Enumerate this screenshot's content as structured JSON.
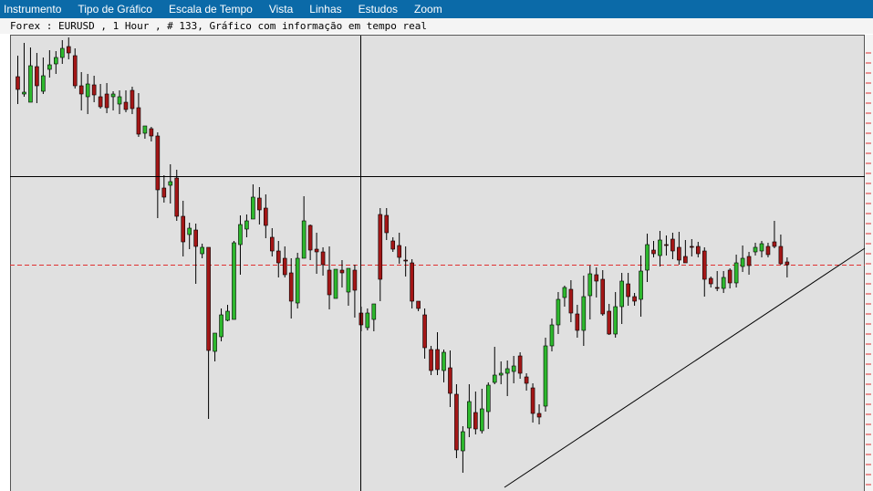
{
  "menu": [
    "Instrumento",
    "Tipo de Gráfico",
    "Escala de Tempo",
    "Vista",
    "Linhas",
    "Estudos",
    "Zoom"
  ],
  "chart_title": "Forex : EURUSD , 1 Hour , # 133, Gráfico com informação em tempo real",
  "colors": {
    "menu_bg": "#0b6aa8",
    "plot_bg": "#e0e0e0",
    "up": "#2db82d",
    "down": "#a31616",
    "ref_line": "#e03030"
  },
  "chart_data": {
    "type": "candlestick",
    "symbol": "EURUSD",
    "timeframe": "1 Hour",
    "candles": [
      [
        84,
        98,
        61,
        114
      ],
      [
        103,
        101,
        47,
        106
      ],
      [
        112,
        72,
        52,
        112
      ],
      [
        73,
        94,
        58,
        113
      ],
      [
        100,
        83,
        63,
        103
      ],
      [
        76,
        71,
        55,
        85
      ],
      [
        70,
        63,
        56,
        81
      ],
      [
        63,
        53,
        44,
        70
      ],
      [
        51,
        58,
        41,
        65
      ],
      [
        61,
        94,
        53,
        97
      ],
      [
        94,
        103,
        79,
        121
      ],
      [
        106,
        92,
        81,
        125
      ],
      [
        93,
        104,
        83,
        112
      ],
      [
        106,
        117,
        92,
        119
      ],
      [
        103,
        118,
        91,
        124
      ],
      [
        106,
        103,
        100,
        121
      ],
      [
        114,
        106,
        99,
        125
      ],
      [
        112,
        120,
        99,
        123
      ],
      [
        99,
        119,
        95,
        125
      ],
      [
        118,
        147,
        102,
        150
      ],
      [
        146,
        138,
        138,
        152
      ],
      [
        141,
        149,
        139,
        155
      ],
      [
        149,
        208,
        145,
        239
      ],
      [
        206,
        216,
        192,
        222
      ],
      [
        203,
        199,
        180,
        223
      ],
      [
        195,
        237,
        186,
        242
      ],
      [
        237,
        265,
        220,
        281
      ],
      [
        257,
        250,
        244,
        273
      ],
      [
        252,
        270,
        245,
        311
      ],
      [
        278,
        271,
        267,
        283
      ],
      [
        271,
        384,
        271,
        459
      ],
      [
        385,
        365,
        365,
        396
      ],
      [
        369,
        345,
        338,
        374
      ],
      [
        351,
        341,
        334,
        352
      ],
      [
        350,
        266,
        264,
        293
      ],
      [
        268,
        246,
        236,
        301
      ],
      [
        251,
        242,
        235,
        260
      ],
      [
        240,
        216,
        202,
        226
      ],
      [
        217,
        230,
        205,
        246
      ],
      [
        228,
        247,
        213,
        261
      ],
      [
        260,
        275,
        250,
        281
      ],
      [
        275,
        288,
        264,
        304
      ],
      [
        283,
        301,
        270,
        304
      ],
      [
        299,
        330,
        283,
        349
      ],
      [
        332,
        283,
        277,
        338
      ],
      [
        283,
        242,
        215,
        272
      ],
      [
        247,
        274,
        246,
        285
      ],
      [
        273,
        276,
        255,
        300
      ],
      [
        276,
        290,
        271,
        302
      ],
      [
        296,
        323,
        270,
        339
      ],
      [
        327,
        295,
        296,
        325
      ],
      [
        296,
        299,
        285,
        315
      ],
      [
        320,
        294,
        294,
        335
      ],
      [
        296,
        318,
        290,
        348
      ],
      [
        343,
        356,
        336,
        363
      ],
      [
        359,
        343,
        338,
        362
      ],
      [
        350,
        333,
        334,
        363
      ],
      [
        235,
        306,
        228,
        330
      ],
      [
        236,
        255,
        228,
        263
      ],
      [
        264,
        273,
        260,
        276
      ],
      [
        269,
        282,
        255,
        289
      ],
      [
        285,
        286,
        270,
        303
      ],
      [
        288,
        330,
        284,
        338
      ],
      [
        330,
        338,
        330,
        341
      ],
      [
        345,
        381,
        338,
        393
      ],
      [
        383,
        406,
        379,
        411
      ],
      [
        383,
        405,
        364,
        411
      ],
      [
        406,
        386,
        383,
        419
      ],
      [
        403,
        431,
        384,
        446
      ],
      [
        432,
        493,
        421,
        502
      ],
      [
        494,
        473,
        467,
        518
      ],
      [
        469,
        440,
        421,
        479
      ],
      [
        452,
        470,
        429,
        476
      ],
      [
        472,
        448,
        426,
        475
      ],
      [
        451,
        422,
        419,
        470
      ],
      [
        419,
        411,
        380,
        421
      ],
      [
        411,
        409,
        396,
        421
      ],
      [
        409,
        404,
        395,
        434
      ],
      [
        407,
        401,
        390,
        420
      ],
      [
        390,
        409,
        386,
        415
      ],
      [
        413,
        420,
        409,
        428
      ],
      [
        425,
        453,
        420,
        463
      ],
      [
        453,
        457,
        443,
        465
      ],
      [
        445,
        379,
        370,
        451
      ],
      [
        379,
        356,
        349,
        385
      ],
      [
        356,
        328,
        320,
        366
      ],
      [
        326,
        315,
        313,
        336
      ],
      [
        317,
        343,
        307,
        353
      ],
      [
        344,
        362,
        334,
        370
      ],
      [
        362,
        325,
        302,
        379
      ],
      [
        324,
        300,
        291,
        350
      ],
      [
        301,
        308,
        293,
        326
      ],
      [
        306,
        344,
        296,
        346
      ],
      [
        341,
        366,
        333,
        367
      ],
      [
        366,
        336,
        320,
        370
      ],
      [
        336,
        308,
        299,
        355
      ],
      [
        311,
        325,
        299,
        335
      ],
      [
        325,
        330,
        321,
        335
      ],
      [
        328,
        297,
        280,
        347
      ],
      [
        296,
        268,
        256,
        309
      ],
      [
        274,
        278,
        264,
        282
      ],
      [
        280,
        263,
        253,
        292
      ],
      [
        268,
        269,
        258,
        280
      ],
      [
        262,
        275,
        255,
        284
      ],
      [
        271,
        285,
        254,
        290
      ],
      [
        281,
        288,
        263,
        288
      ],
      [
        270,
        270,
        262,
        281
      ],
      [
        270,
        278,
        265,
        282
      ],
      [
        275,
        306,
        271,
        325
      ],
      [
        305,
        311,
        303,
        315
      ],
      [
        315,
        315,
        297,
        319
      ],
      [
        316,
        304,
        297,
        321
      ],
      [
        296,
        310,
        294,
        316
      ],
      [
        310,
        288,
        279,
        315
      ],
      [
        292,
        283,
        269,
        298
      ],
      [
        281,
        291,
        276,
        301
      ],
      [
        276,
        271,
        266,
        280
      ],
      [
        275,
        267,
        264,
        282
      ],
      [
        270,
        279,
        266,
        282
      ],
      [
        265,
        270,
        242,
        272
      ],
      [
        270,
        289,
        257,
        290
      ],
      [
        287,
        290,
        282,
        304
      ]
    ],
    "reference_price_line": "dashed red",
    "trendline": "from low of candle 71 to last candle",
    "crosshair": "vertical and horizontal",
    "legend": "none",
    "ylabel": "",
    "xlabel": ""
  }
}
